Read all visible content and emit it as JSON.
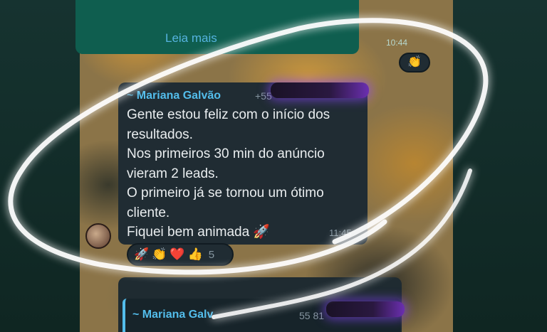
{
  "previous_message": {
    "link": "Leia mais",
    "time": "10:44",
    "reaction": "👏"
  },
  "message": {
    "sender": "Mariana Galvão",
    "tilde": "~",
    "phone": "+55",
    "lines": [
      "Gente estou feliz com o início dos",
      "resultados.",
      "Nos primeiros 30 min do anúncio",
      "vieram 2 leads.",
      "O primeiro já se tornou um ótimo",
      "cliente.",
      "Fiquei bem animada 🚀"
    ],
    "time": "11:45",
    "reactions": [
      "🚀",
      "👏",
      "❤️",
      "👍"
    ],
    "reaction_count": "5"
  },
  "reply": {
    "author": "",
    "quote_sender": "~ Mariana Galv",
    "quote_phone": "55 81",
    "quote_text": ""
  },
  "colors": {
    "sender": "#53bdeb",
    "bubble": "#202c33",
    "highlight": "#ffffff"
  }
}
